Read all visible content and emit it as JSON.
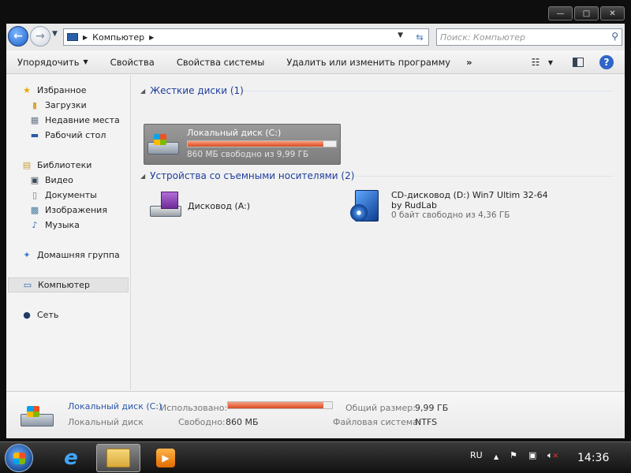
{
  "window": {
    "minimize": "—",
    "maximize": "□",
    "close": "✕"
  },
  "address": {
    "path": "Компьютер",
    "search_placeholder": "Поиск: Компьютер"
  },
  "toolbar": {
    "organize": "Упорядочить",
    "properties": "Свойства",
    "system_properties": "Свойства системы",
    "uninstall": "Удалить или изменить программу",
    "more": "»"
  },
  "nav": {
    "favorites": "Избранное",
    "downloads": "Загрузки",
    "recent": "Недавние места",
    "desktop": "Рабочий стол",
    "libraries": "Библиотеки",
    "video": "Видео",
    "documents": "Документы",
    "pictures": "Изображения",
    "music": "Музыка",
    "homegroup": "Домашняя группа",
    "computer": "Компьютер",
    "network": "Сеть"
  },
  "groups": {
    "hdd": "Жесткие диски (1)",
    "removable": "Устройства со съемными носителями (2)"
  },
  "drives": {
    "c": {
      "name": "Локальный диск (C:)",
      "free": "860 МБ свободно из 9,99 ГБ",
      "used_fraction": 0.916
    },
    "a": {
      "name": "Дисковод (A:)"
    },
    "d": {
      "name": "CD-дисковод (D:) Win7 Ultim 32-64",
      "name2": "by RudLab",
      "free": "0 байт свободно из 4,36 ГБ"
    }
  },
  "details": {
    "title": "Локальный диск (C:)",
    "subtitle": "Локальный диск",
    "used_label": "Использовано:",
    "used_fraction": 0.916,
    "free_label": "Свободно:",
    "free_value": "860 МБ",
    "total_label": "Общий размер:",
    "total_value": "9,99 ГБ",
    "fs_label": "Файловая система:",
    "fs_value": "NTFS"
  },
  "tray": {
    "lang": "RU",
    "time": "14:36"
  },
  "colors": {
    "accent": "#1e3d9b",
    "bar_fill": "#d84a24"
  }
}
